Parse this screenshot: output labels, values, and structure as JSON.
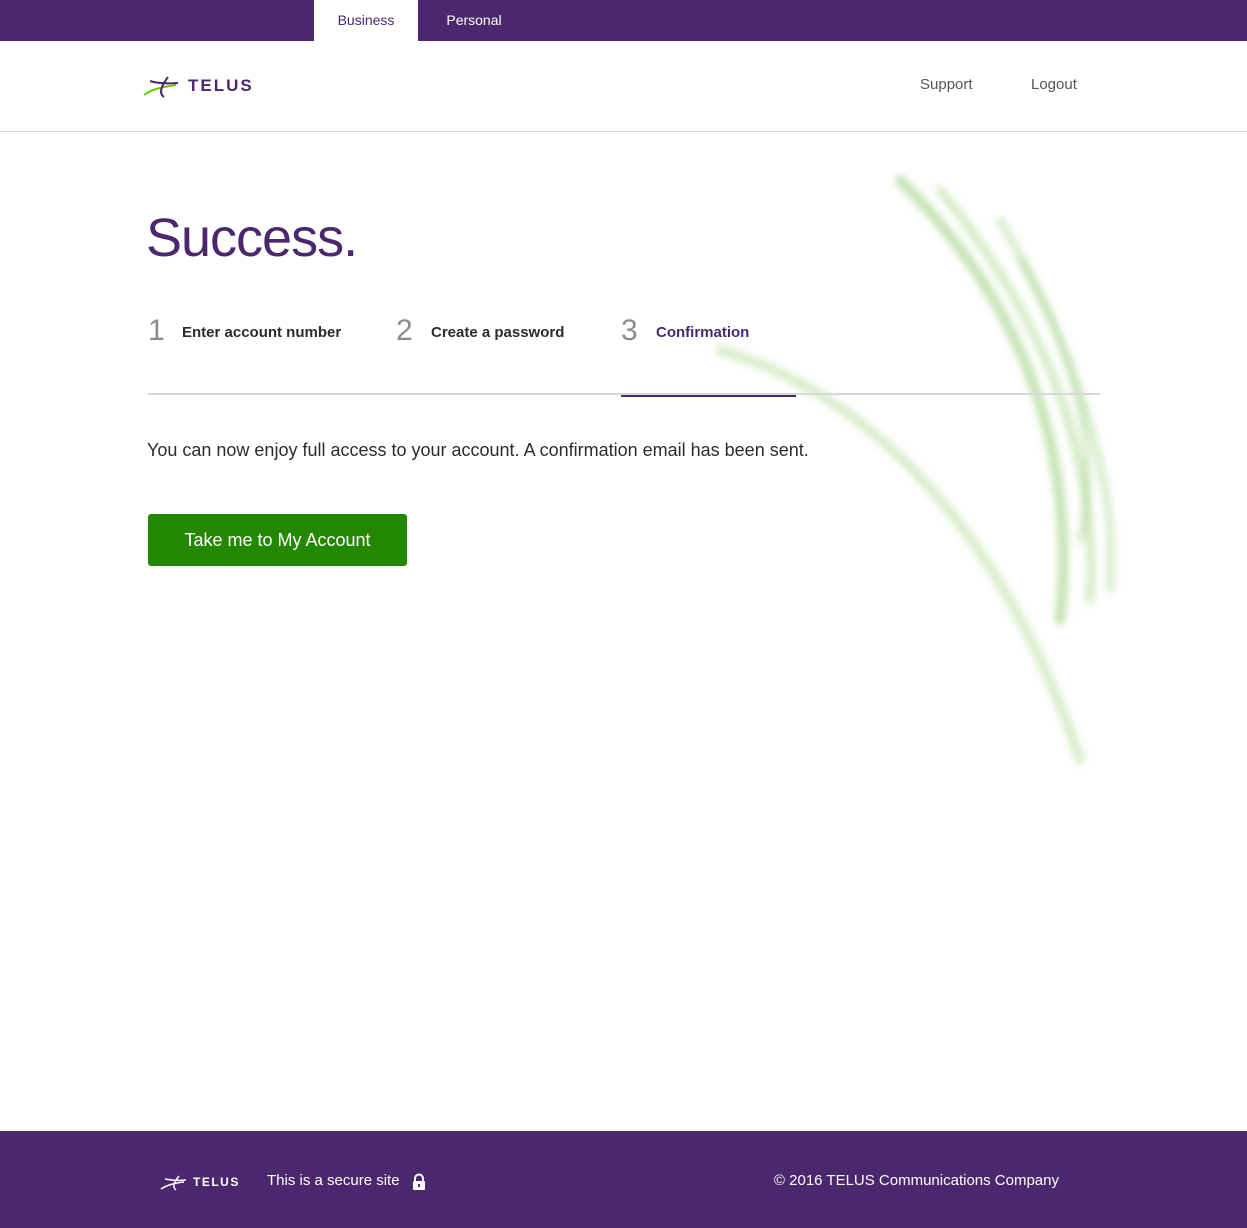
{
  "topbar": {
    "tab_business": "Business",
    "tab_personal": "Personal"
  },
  "header": {
    "logo_text": "TELUS",
    "support": "Support",
    "logout": "Logout"
  },
  "main": {
    "title": "Success.",
    "steps": [
      {
        "number": "1",
        "label": "Enter account number"
      },
      {
        "number": "2",
        "label": "Create a password"
      },
      {
        "number": "3",
        "label": "Confirmation"
      }
    ],
    "message": "You can now enjoy full access to your account. A confirmation email has been sent.",
    "button": "Take me to My Account"
  },
  "footer": {
    "logo_text": "TELUS",
    "secure": "This is a secure site",
    "copyright": "© 2016 TELUS Communications Company"
  },
  "colors": {
    "brand_purple": "#4b286d",
    "cta_green": "#248700",
    "accent_green": "#66cc00"
  },
  "icons": {
    "lock": "lock-icon",
    "logo": "telus-logo-icon"
  }
}
